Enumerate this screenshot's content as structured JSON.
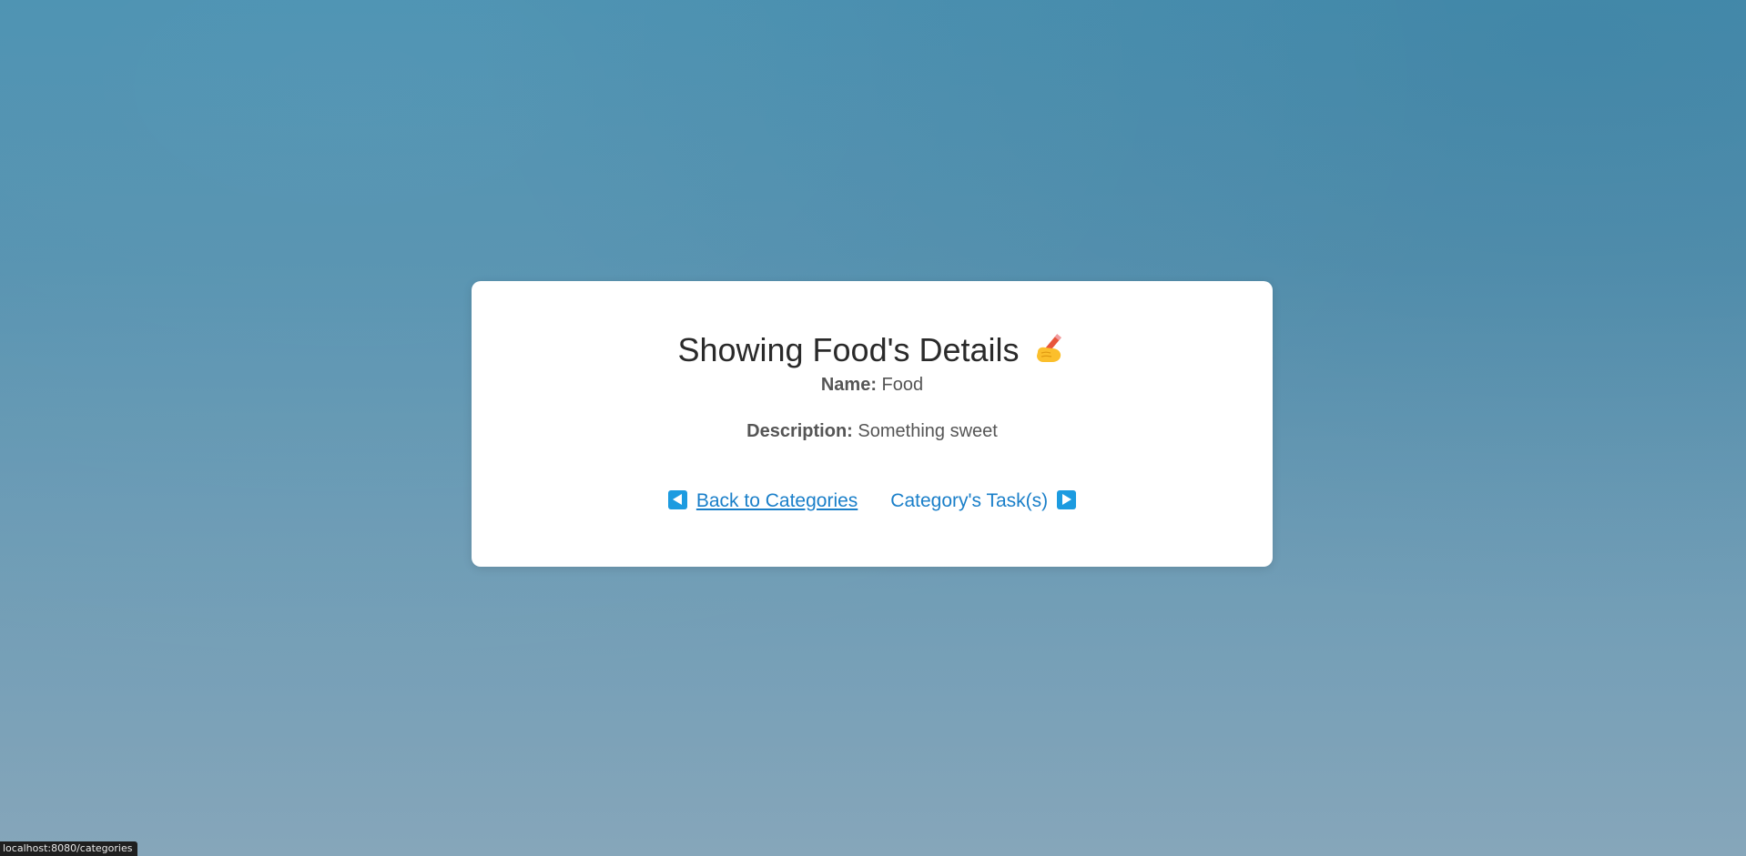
{
  "page": {
    "title": "Showing Food's Details",
    "title_icon": "writing-hand-icon"
  },
  "details": {
    "name_label": "Name:",
    "name_value": "Food",
    "description_label": "Description:",
    "description_value": "Something sweet"
  },
  "links": {
    "back_label": "Back to Categories",
    "back_icon": "left-arrow-icon",
    "tasks_label": "Category's Task(s)",
    "tasks_icon": "right-arrow-icon"
  },
  "status_bar": {
    "url": "localhost:8080/categories"
  },
  "colors": {
    "link": "#1a7fc9",
    "arrow_box": "#1c9be0",
    "card": "#ffffff",
    "background_top": "#4a91b1",
    "background_bottom": "#86a6ba"
  }
}
